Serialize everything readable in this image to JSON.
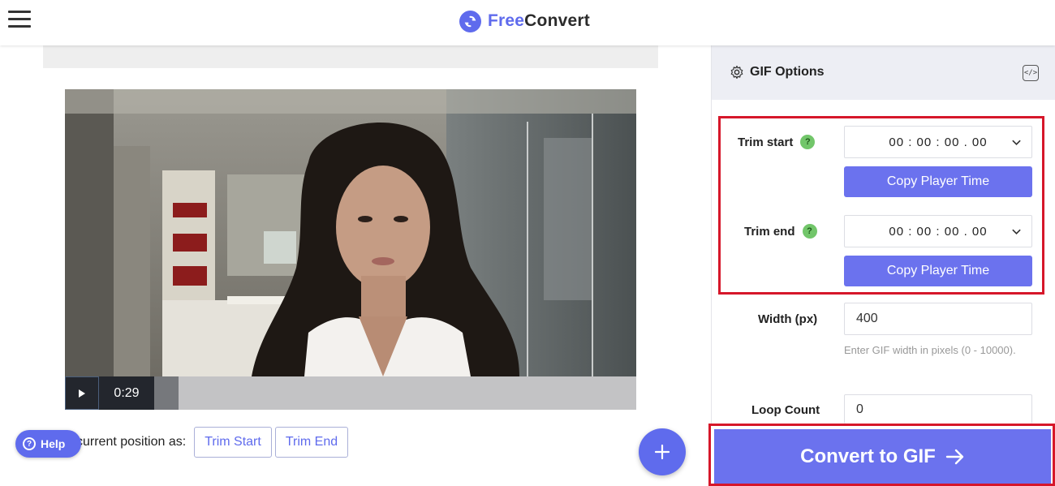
{
  "header": {
    "brand_part1": "Free",
    "brand_part2": "Convert",
    "menu_icon": "hamburger-menu-icon"
  },
  "player": {
    "current_time": "0:29",
    "play_icon": "play-icon",
    "progress_fraction": 0.05
  },
  "set_position": {
    "label": "current position as:",
    "trim_start_label": "Trim Start",
    "trim_end_label": "Trim End"
  },
  "help": {
    "label": "Help",
    "icon_glyph": "?"
  },
  "fab": {
    "icon": "plus-icon"
  },
  "options": {
    "title": "GIF Options",
    "title_icon": "gear-icon",
    "code_icon": "code-icon",
    "trim_start": {
      "label": "Trim start",
      "help_glyph": "?",
      "value": "00 : 00 : 00 . 00",
      "copy_label": "Copy Player Time"
    },
    "trim_end": {
      "label": "Trim end",
      "help_glyph": "?",
      "value": "00 : 00 : 00 . 00",
      "copy_label": "Copy Player Time"
    },
    "width": {
      "label": "Width (px)",
      "value": "400",
      "hint": "Enter GIF width in pixels (0 - 10000)."
    },
    "loop_count": {
      "label": "Loop Count",
      "value": "0"
    }
  },
  "convert": {
    "label": "Convert to GIF",
    "icon": "arrow-right-icon"
  },
  "colors": {
    "accent": "#5f6bed",
    "button": "#6b72ee",
    "highlight_border": "#d6172a",
    "help_badge": "#72c66a"
  }
}
